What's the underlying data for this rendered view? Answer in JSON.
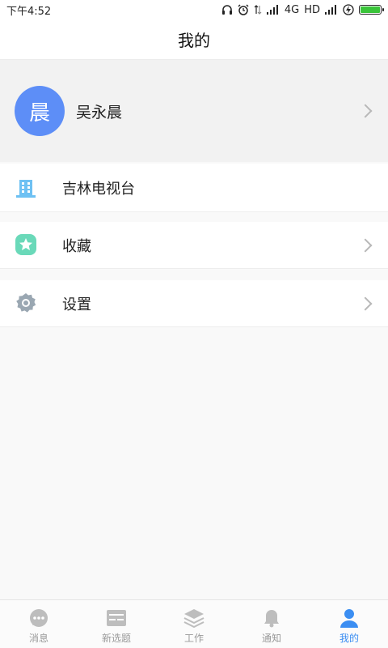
{
  "status_bar": {
    "time": "下午4:52",
    "network": "4G",
    "hd": "HD",
    "icons": [
      "headphones-icon",
      "alarm-icon",
      "data-arrows-icon",
      "signal-icon",
      "signal-icon",
      "charging-icon",
      "battery-icon"
    ]
  },
  "header": {
    "title": "我的"
  },
  "profile": {
    "avatar_text": "晨",
    "name": "吴永晨",
    "avatar_color": "#5d8ef7"
  },
  "menu": [
    {
      "label": "吉林电视台",
      "icon": "building-icon",
      "has_chevron": false
    },
    {
      "label": "收藏",
      "icon": "star-icon",
      "has_chevron": true
    },
    {
      "label": "设置",
      "icon": "gear-icon",
      "has_chevron": true
    }
  ],
  "tabs": [
    {
      "label": "消息",
      "icon": "chat-bubble-icon",
      "active": false
    },
    {
      "label": "新选题",
      "icon": "inbox-icon",
      "active": false
    },
    {
      "label": "工作",
      "icon": "layers-icon",
      "active": false
    },
    {
      "label": "通知",
      "icon": "bell-icon",
      "active": false
    },
    {
      "label": "我的",
      "icon": "person-icon",
      "active": true
    }
  ],
  "colors": {
    "accent": "#3b8ef2",
    "avatar": "#5d8ef7",
    "building": "#6ec1f3",
    "star": "#6ad9b9",
    "gear": "#9aa7b2",
    "tab_inactive": "#bdbdbd"
  }
}
